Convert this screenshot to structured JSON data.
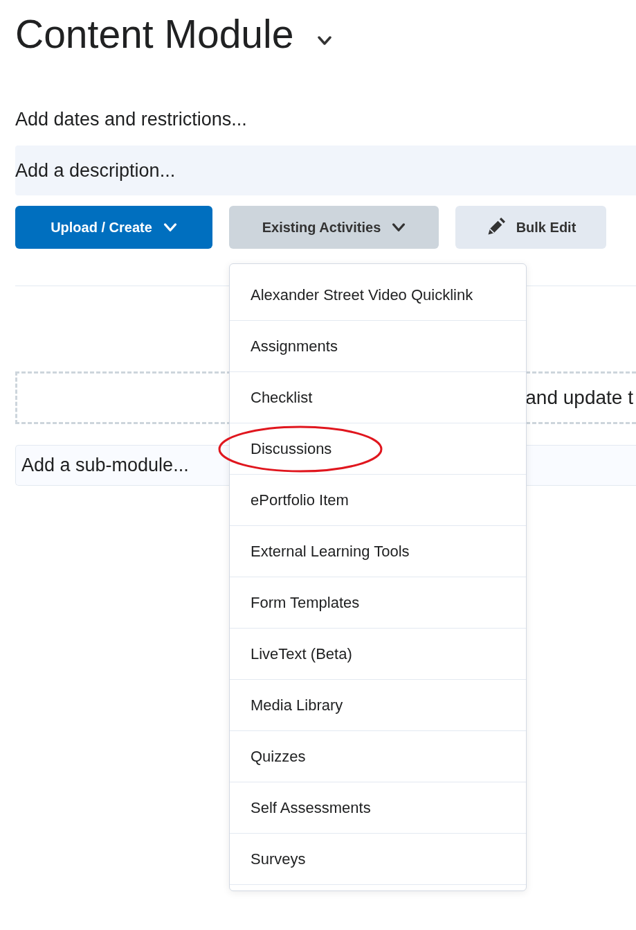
{
  "title": "Content Module",
  "dates_link": "Add dates and restrictions...",
  "description": {
    "placeholder": "Add a description..."
  },
  "buttons": [
    {
      "kind": "primary",
      "label": "Upload / Create"
    },
    {
      "kind": "secondary",
      "label": "Existing Activities",
      "expanded": true
    },
    {
      "kind": "tertiary",
      "label": "Bulk Edit"
    }
  ],
  "drop_zone": {
    "text": "and update t"
  },
  "sub_module": {
    "placeholder": "Add a sub-module..."
  },
  "menu": {
    "items": [
      {
        "label": "Alexander Street Video Quicklink",
        "circled": false
      },
      {
        "label": "Assignments",
        "circled": false
      },
      {
        "label": "Checklist",
        "circled": false
      },
      {
        "label": "Discussions",
        "circled": true
      },
      {
        "label": "ePortfolio Item",
        "circled": false
      },
      {
        "label": "External Learning Tools",
        "circled": false
      },
      {
        "label": "Form Templates",
        "circled": false
      },
      {
        "label": "LiveText (Beta)",
        "circled": false
      },
      {
        "label": "Media Library",
        "circled": false
      },
      {
        "label": "Quizzes",
        "circled": false
      },
      {
        "label": "Self Assessments",
        "circled": false
      },
      {
        "label": "Surveys",
        "circled": false
      }
    ]
  }
}
